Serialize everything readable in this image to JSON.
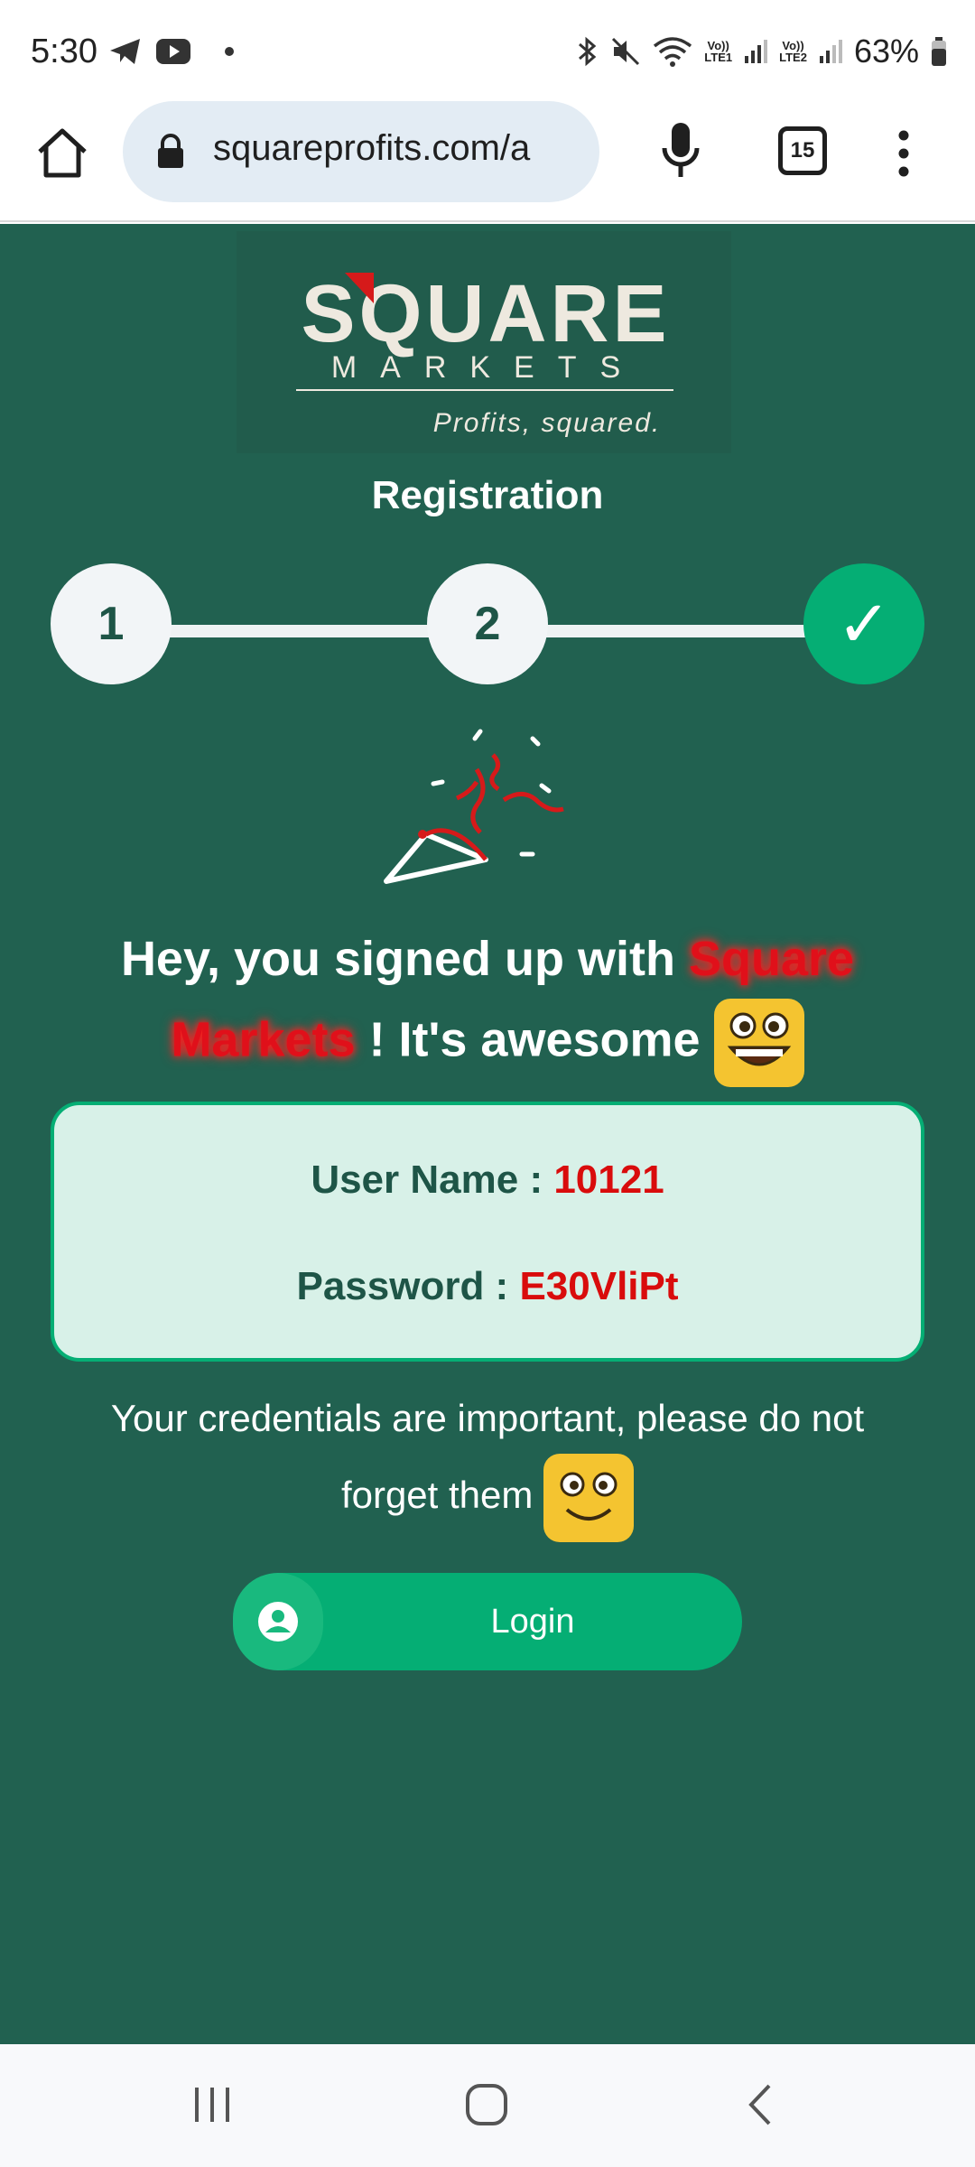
{
  "status_bar": {
    "time": "5:30",
    "battery": "63%",
    "sim1_line1": "Vo))",
    "sim1_line2": "LTE1",
    "sim2_line1": "Vo))",
    "sim2_line2": "LTE2"
  },
  "browser": {
    "url": "squareprofits.com/a",
    "tab_count": "15"
  },
  "logo": {
    "brand": "SQUARE",
    "sub": "MARKETS",
    "tagline": "Profits, squared."
  },
  "page": {
    "title": "Registration",
    "steps": [
      "1",
      "2",
      "✓"
    ],
    "message_before": "Hey, you signed up with ",
    "brand_word_1": "Square",
    "brand_word_2": "Markets",
    "message_after": " ! It's awesome ",
    "credentials": {
      "username_label": "User Name : ",
      "username_value": "10121",
      "password_label": "Password : ",
      "password_value": "E30VliPt"
    },
    "note": "Your credentials are important, please do not forget them",
    "login_label": "Login"
  },
  "colors": {
    "page_bg": "#216150",
    "accent": "#05ae74",
    "credential_value": "#d90c0c"
  }
}
